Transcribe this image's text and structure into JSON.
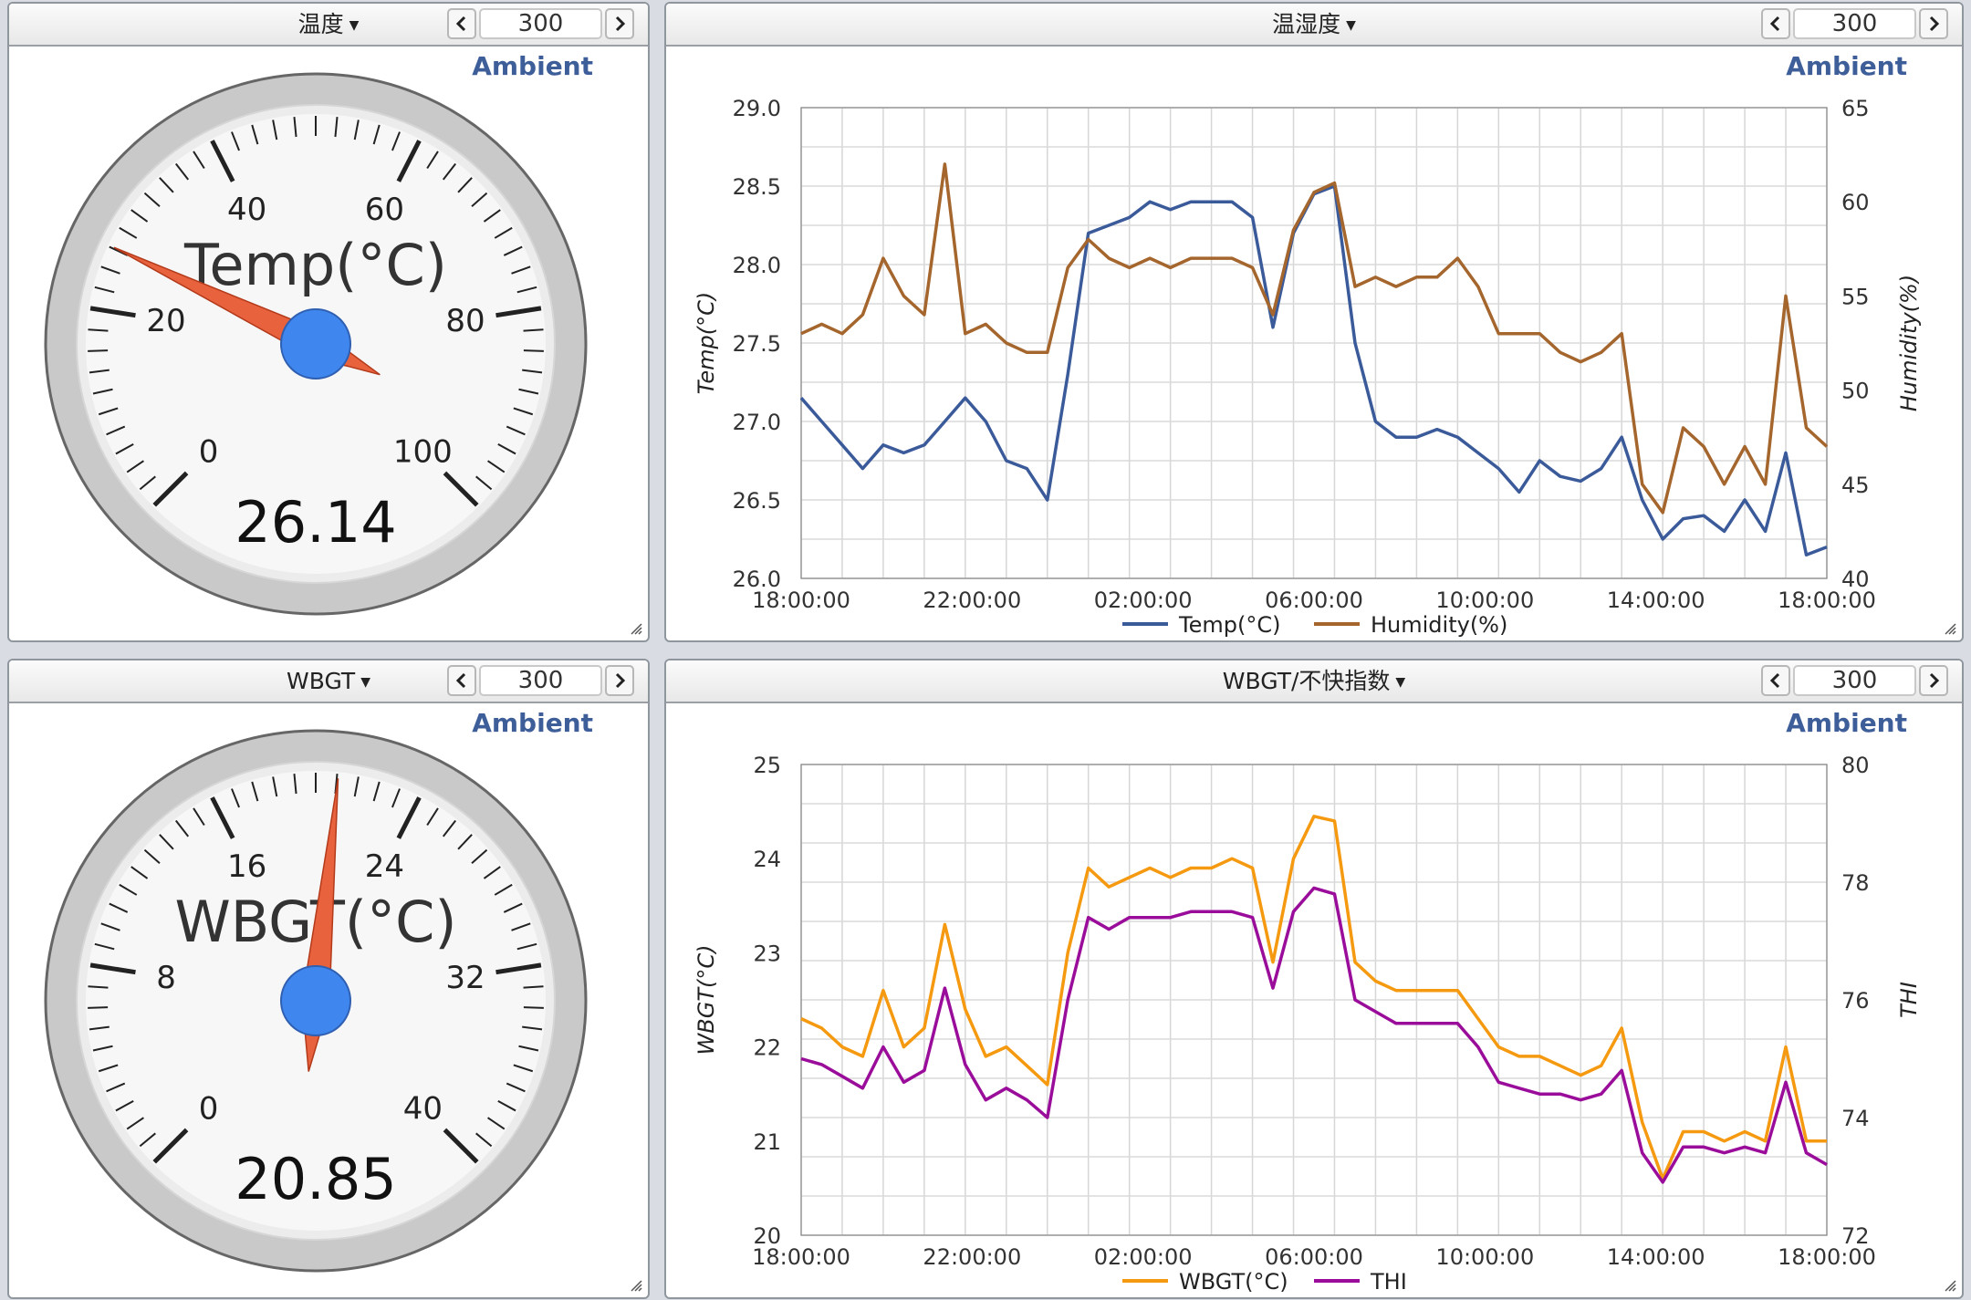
{
  "panels": {
    "temp_gauge": {
      "title": "温度",
      "range": "300",
      "badge": "Ambient",
      "gauge": {
        "label": "Temp(°C)",
        "value": "26.14",
        "value_num": 26.14,
        "min": 0,
        "max": 100,
        "ticks": [
          "0",
          "20",
          "40",
          "60",
          "80",
          "100"
        ]
      }
    },
    "wbgt_gauge": {
      "title": "WBGT",
      "range": "300",
      "badge": "Ambient",
      "gauge": {
        "label": "WBGT(°C)",
        "value": "20.85",
        "value_num": 20.85,
        "min": 0,
        "max": 40,
        "ticks": [
          "0",
          "8",
          "16",
          "24",
          "32",
          "40"
        ]
      }
    },
    "humid_chart": {
      "title": "温湿度",
      "range": "300",
      "badge": "Ambient"
    },
    "wbgt_chart": {
      "title": "WBGT/不快指数",
      "range": "300",
      "badge": "Ambient"
    }
  },
  "colors": {
    "temp": "#3a5a9a",
    "humidity": "#a5662e",
    "wbgt": "#f59a10",
    "thi": "#9a0d9a",
    "needle": "#e8623e",
    "hub": "#3f86ee"
  },
  "chart_data": [
    {
      "type": "line",
      "xticks": [
        "18:00:00",
        "22:00:00",
        "02:00:00",
        "06:00:00",
        "10:00:00",
        "14:00:00",
        "18:00:00"
      ],
      "ylabel": "Temp(°C)",
      "ylim": [
        26.0,
        29.0
      ],
      "yticks": [
        "26.0",
        "26.5",
        "27.0",
        "27.5",
        "28.0",
        "28.5",
        "29.0"
      ],
      "y2label": "Humidity(%)",
      "y2lim": [
        40,
        65
      ],
      "y2ticks": [
        "40",
        "45",
        "50",
        "55",
        "60",
        "65"
      ],
      "series": [
        {
          "name": "Temp(°C)",
          "axis": "left",
          "x": [
            0,
            0.5,
            1,
            1.5,
            2,
            2.5,
            3,
            3.5,
            4,
            4.5,
            5,
            5.5,
            6,
            6.5,
            7,
            7.5,
            8,
            8.5,
            9,
            9.5,
            10,
            10.5,
            11,
            11.5,
            12,
            12.5,
            13,
            13.5,
            14,
            14.5,
            15,
            15.5,
            16,
            16.5,
            17,
            17.5,
            18,
            18.5,
            19,
            19.5,
            20,
            20.5,
            21,
            21.5,
            22,
            22.5,
            23,
            23.5,
            24,
            24.5,
            25
          ],
          "values": [
            27.15,
            27.0,
            26.85,
            26.7,
            26.85,
            26.8,
            26.85,
            27.0,
            27.15,
            27.0,
            26.75,
            26.7,
            26.5,
            27.3,
            28.2,
            28.25,
            28.3,
            28.4,
            28.35,
            28.4,
            28.4,
            28.4,
            28.3,
            27.6,
            28.2,
            28.45,
            28.5,
            27.5,
            27.0,
            26.9,
            26.9,
            26.95,
            26.9,
            26.8,
            26.7,
            26.55,
            26.75,
            26.65,
            26.62,
            26.7,
            26.9,
            26.5,
            26.25,
            26.38,
            26.4,
            26.3,
            26.5,
            26.3,
            26.8,
            26.15,
            26.2
          ]
        },
        {
          "name": "Humidity(%)",
          "axis": "right",
          "x": [
            0,
            0.5,
            1,
            1.5,
            2,
            2.5,
            3,
            3.5,
            4,
            4.5,
            5,
            5.5,
            6,
            6.5,
            7,
            7.5,
            8,
            8.5,
            9,
            9.5,
            10,
            10.5,
            11,
            11.5,
            12,
            12.5,
            13,
            13.5,
            14,
            14.5,
            15,
            15.5,
            16,
            16.5,
            17,
            17.5,
            18,
            18.5,
            19,
            19.5,
            20,
            20.5,
            21,
            21.5,
            22,
            22.5,
            23,
            23.5,
            24,
            24.5,
            25
          ],
          "values": [
            53,
            53.5,
            53,
            54,
            57,
            55,
            54,
            62,
            53,
            53.5,
            52.5,
            52,
            52,
            56.5,
            58,
            57,
            56.5,
            57,
            56.5,
            57,
            57,
            57,
            56.5,
            54,
            58.5,
            60.5,
            61,
            55.5,
            56,
            55.5,
            56,
            56,
            57,
            55.5,
            53,
            53,
            53,
            52,
            51.5,
            52,
            53,
            45,
            43.5,
            48,
            47,
            45,
            47,
            45,
            55,
            48,
            47
          ]
        }
      ],
      "legend": "bottom"
    },
    {
      "type": "line",
      "xticks": [
        "18:00:00",
        "22:00:00",
        "02:00:00",
        "06:00:00",
        "10:00:00",
        "14:00:00",
        "18:00:00"
      ],
      "ylabel": "WBGT(°C)",
      "ylim": [
        20,
        25
      ],
      "yticks": [
        "20",
        "21",
        "22",
        "23",
        "24",
        "25"
      ],
      "y2label": "THI",
      "y2lim": [
        72,
        80
      ],
      "y2ticks": [
        "72",
        "74",
        "76",
        "78",
        "80"
      ],
      "series": [
        {
          "name": "WBGT(°C)",
          "axis": "left",
          "x": [
            0,
            0.5,
            1,
            1.5,
            2,
            2.5,
            3,
            3.5,
            4,
            4.5,
            5,
            5.5,
            6,
            6.5,
            7,
            7.5,
            8,
            8.5,
            9,
            9.5,
            10,
            10.5,
            11,
            11.5,
            12,
            12.5,
            13,
            13.5,
            14,
            14.5,
            15,
            15.5,
            16,
            16.5,
            17,
            17.5,
            18,
            18.5,
            19,
            19.5,
            20,
            20.5,
            21,
            21.5,
            22,
            22.5,
            23,
            23.5,
            24,
            24.5,
            25
          ],
          "values": [
            22.3,
            22.2,
            22.0,
            21.9,
            22.6,
            22.0,
            22.2,
            23.3,
            22.4,
            21.9,
            22.0,
            21.8,
            21.6,
            23.0,
            23.9,
            23.7,
            23.8,
            23.9,
            23.8,
            23.9,
            23.9,
            24.0,
            23.9,
            22.9,
            24.0,
            24.45,
            24.4,
            22.9,
            22.7,
            22.6,
            22.6,
            22.6,
            22.6,
            22.3,
            22.0,
            21.9,
            21.9,
            21.8,
            21.7,
            21.8,
            22.2,
            21.2,
            20.6,
            21.1,
            21.1,
            21.0,
            21.1,
            21.0,
            22.0,
            21.0,
            21.0
          ]
        },
        {
          "name": "THI",
          "axis": "right",
          "x": [
            0,
            0.5,
            1,
            1.5,
            2,
            2.5,
            3,
            3.5,
            4,
            4.5,
            5,
            5.5,
            6,
            6.5,
            7,
            7.5,
            8,
            8.5,
            9,
            9.5,
            10,
            10.5,
            11,
            11.5,
            12,
            12.5,
            13,
            13.5,
            14,
            14.5,
            15,
            15.5,
            16,
            16.5,
            17,
            17.5,
            18,
            18.5,
            19,
            19.5,
            20,
            20.5,
            21,
            21.5,
            22,
            22.5,
            23,
            23.5,
            24,
            24.5,
            25
          ],
          "values": [
            75.0,
            74.9,
            74.7,
            74.5,
            75.2,
            74.6,
            74.8,
            76.2,
            74.9,
            74.3,
            74.5,
            74.3,
            74.0,
            76.0,
            77.4,
            77.2,
            77.4,
            77.4,
            77.4,
            77.5,
            77.5,
            77.5,
            77.4,
            76.2,
            77.5,
            77.9,
            77.8,
            76.0,
            75.8,
            75.6,
            75.6,
            75.6,
            75.6,
            75.2,
            74.6,
            74.5,
            74.4,
            74.4,
            74.3,
            74.4,
            74.8,
            73.4,
            72.9,
            73.5,
            73.5,
            73.4,
            73.5,
            73.4,
            74.6,
            73.4,
            73.2
          ]
        }
      ],
      "legend": "bottom"
    }
  ]
}
